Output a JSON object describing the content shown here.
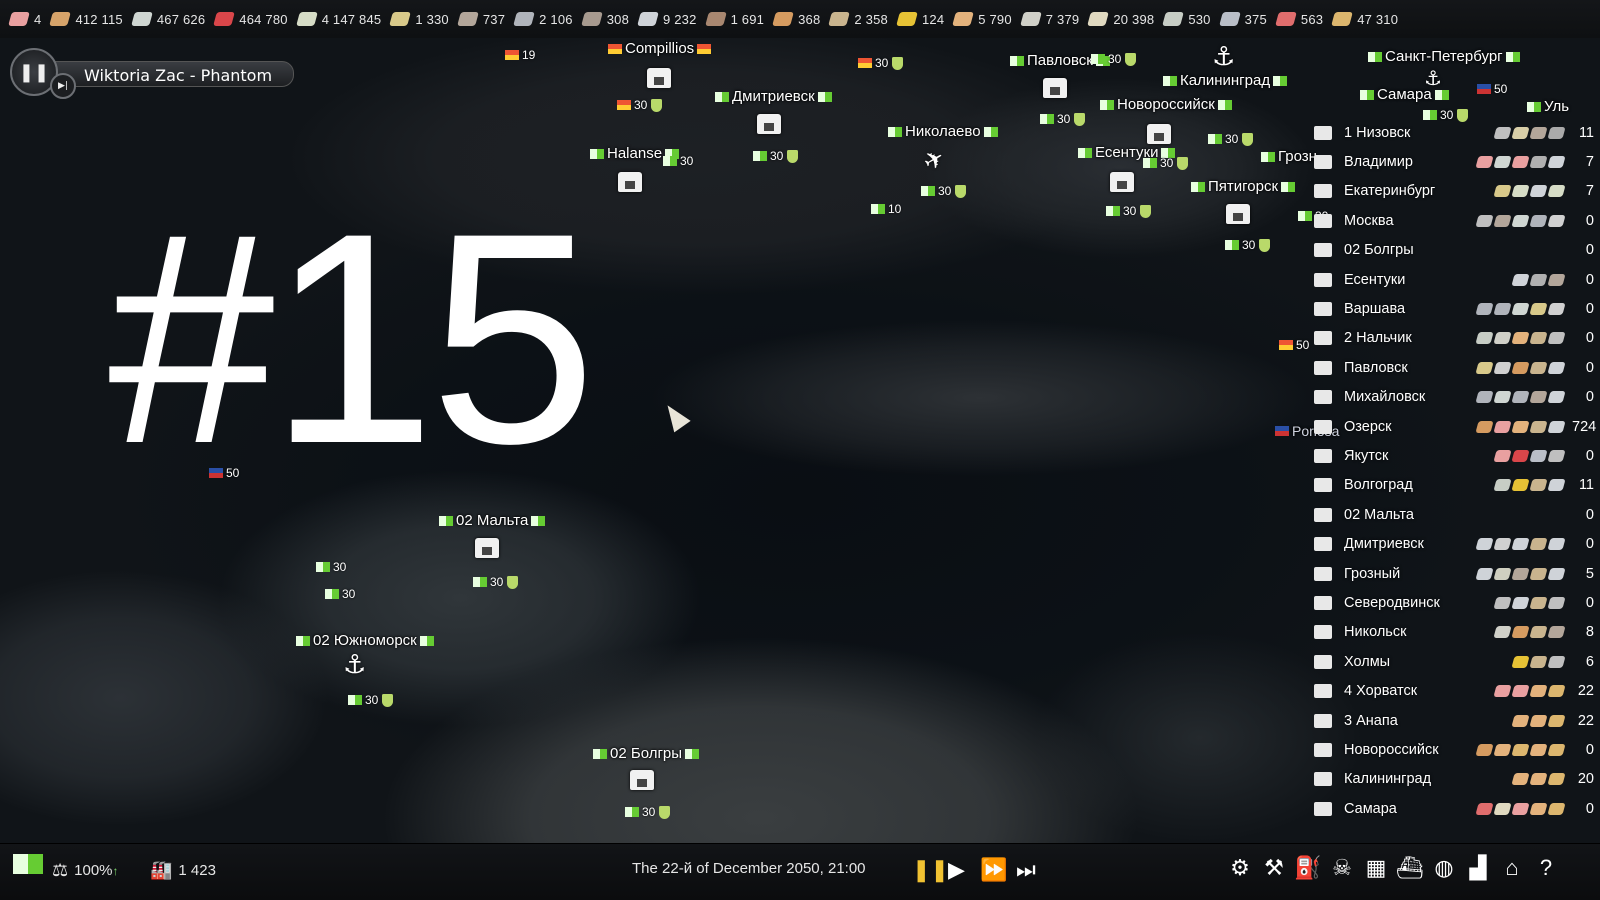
{
  "resources": [
    {
      "value": "4",
      "color": "#e9a0a0"
    },
    {
      "value": "412 115",
      "color": "#d6a36a"
    },
    {
      "value": "467 626",
      "color": "#cfd6d2"
    },
    {
      "value": "464 780",
      "color": "#d9464a"
    },
    {
      "value": "4 147 845",
      "color": "#d6dcc6"
    },
    {
      "value": "1 330",
      "color": "#d8c98a"
    },
    {
      "value": "737",
      "color": "#b3a69a"
    },
    {
      "value": "2 106",
      "color": "#b0b4bb"
    },
    {
      "value": "308",
      "color": "#a79a8f"
    },
    {
      "value": "9 232",
      "color": "#cfd3d8"
    },
    {
      "value": "1 691",
      "color": "#a88770"
    },
    {
      "value": "368",
      "color": "#d59b60"
    },
    {
      "value": "2 358",
      "color": "#c9b48e"
    },
    {
      "value": "124",
      "color": "#e6c235"
    },
    {
      "value": "5 790",
      "color": "#e3b27c"
    },
    {
      "value": "7 379",
      "color": "#d0d0c8"
    },
    {
      "value": "20 398",
      "color": "#e0d9c0"
    },
    {
      "value": "530",
      "color": "#c7cdc5"
    },
    {
      "value": "375",
      "color": "#b9bec7"
    },
    {
      "value": "563",
      "color": "#e06d6d"
    },
    {
      "value": "47 310",
      "color": "#dcb66e"
    }
  ],
  "player": {
    "track": "Wiktoria Zac - Phantom",
    "pause_icon": "pause-icon",
    "next_icon": "skip-next-icon"
  },
  "episode": "#15",
  "map": {
    "cities": [
      {
        "name": "Compillios",
        "flag": "red"
      },
      {
        "name": "Дмитриевск",
        "flag": "green"
      },
      {
        "name": "Halanse",
        "flag": "green"
      },
      {
        "name": "Николаево",
        "flag": "green"
      },
      {
        "name": "Павловск",
        "flag": "green"
      },
      {
        "name": "Калининград",
        "flag": "green"
      },
      {
        "name": "Новороссийск",
        "flag": "green"
      },
      {
        "name": "Есентуки",
        "flag": "green"
      },
      {
        "name": "Пятигорск",
        "flag": "green"
      },
      {
        "name": "Грозн",
        "flag": "green"
      },
      {
        "name": "Санкт-Петербург",
        "flag": "green"
      },
      {
        "name": "Самара",
        "flag": "green"
      },
      {
        "name": "Уль",
        "flag": "green"
      },
      {
        "name": "02 Мальта",
        "flag": "green"
      },
      {
        "name": "02 Южноморск",
        "flag": "green"
      },
      {
        "name": "02 Болгры",
        "flag": "green"
      },
      {
        "name": "Poriosa",
        "flag": "blue"
      }
    ],
    "garrisons": [
      "19",
      "30",
      "30",
      "30",
      "30",
      "30",
      "10",
      "30",
      "30",
      "30",
      "30",
      "30",
      "30",
      "30",
      "50",
      "50",
      "50",
      "30",
      "30",
      "30",
      "30",
      "30",
      "30"
    ]
  },
  "city_list": [
    {
      "name": "1 Низовск",
      "count": "11",
      "goods": [
        "#bfbfbf",
        "#d9cfa8",
        "#b3a69a",
        "#aaaaaa"
      ]
    },
    {
      "name": "Владимир",
      "count": "7",
      "goods": [
        "#e9a0a0",
        "#cfd6d2",
        "#e9a0a0",
        "#b0b0b0",
        "#cfd3d8"
      ]
    },
    {
      "name": "Екатеринбург",
      "count": "7",
      "goods": [
        "#d8c98a",
        "#d6dcc6",
        "#cfd3d8",
        "#d6dcc6"
      ]
    },
    {
      "name": "Москва",
      "count": "0",
      "goods": [
        "#bfbfbf",
        "#b3a69a",
        "#cfd6d2",
        "#b0b4bb",
        "#d0d0d0"
      ]
    },
    {
      "name": "02 Болгры",
      "count": "0",
      "goods": []
    },
    {
      "name": "Есентуки",
      "count": "0",
      "goods": [
        "#cfd3d8",
        "#b0b0b0",
        "#b3a69a"
      ]
    },
    {
      "name": "Варшава",
      "count": "0",
      "goods": [
        "#b0b4bb",
        "#b0b4bb",
        "#cfd6d2",
        "#d8c98a",
        "#d0d0d0"
      ]
    },
    {
      "name": "2 Нальчик",
      "count": "0",
      "goods": [
        "#c7cdc5",
        "#d0d0c8",
        "#e3b27c",
        "#c9b48e",
        "#bfbfbf"
      ]
    },
    {
      "name": "Павловск",
      "count": "0",
      "goods": [
        "#d8c98a",
        "#d0d0d0",
        "#d59b60",
        "#c9b48e",
        "#cfd3d8"
      ]
    },
    {
      "name": "Михайловск",
      "count": "0",
      "goods": [
        "#b0b4bb",
        "#cfd6d2",
        "#b0b4bb",
        "#b3a69a",
        "#cfd3d8"
      ]
    },
    {
      "name": "Озерск",
      "count": "724",
      "goods": [
        "#d59b60",
        "#e9a0a0",
        "#e3b27c",
        "#c9b48e",
        "#cfd3d8"
      ]
    },
    {
      "name": "Якутск",
      "count": "0",
      "goods": [
        "#e9a0a0",
        "#d9464a",
        "#b9bec7",
        "#bfbfbf"
      ]
    },
    {
      "name": "Волгоград",
      "count": "11",
      "goods": [
        "#c7cdc5",
        "#e6c235",
        "#c9b48e",
        "#cfd3d8"
      ]
    },
    {
      "name": "02 Мальта",
      "count": "0",
      "goods": []
    },
    {
      "name": "Дмитриевск",
      "count": "0",
      "goods": [
        "#cfd3d8",
        "#d0d0d0",
        "#cfd3d8",
        "#c9b48e",
        "#cfd3d8"
      ]
    },
    {
      "name": "Грозный",
      "count": "5",
      "goods": [
        "#cfd3d8",
        "#cfcfc0",
        "#b3a69a",
        "#c9b48e",
        "#cfd3d8"
      ]
    },
    {
      "name": "Северодвинск",
      "count": "0",
      "goods": [
        "#bfbfbf",
        "#cfd3d8",
        "#c9b48e",
        "#bfbfbf"
      ]
    },
    {
      "name": "Никольск",
      "count": "8",
      "goods": [
        "#d0d0c8",
        "#d59b60",
        "#c9b48e",
        "#b3a69a"
      ]
    },
    {
      "name": "Холмы",
      "count": "6",
      "goods": [
        "#e6c235",
        "#c9b48e",
        "#bfbfbf"
      ]
    },
    {
      "name": "4 Хорватск",
      "count": "22",
      "goods": [
        "#e9a0a0",
        "#e9a0a0",
        "#e3b27c",
        "#dcb66e"
      ]
    },
    {
      "name": "3 Анапа",
      "count": "22",
      "goods": [
        "#e3b27c",
        "#e3b27c",
        "#dcb66e"
      ]
    },
    {
      "name": "Новороссийск",
      "count": "0",
      "goods": [
        "#d59b60",
        "#e3b27c",
        "#dcb66e",
        "#e3b27c",
        "#dcb66e"
      ]
    },
    {
      "name": "Калининград",
      "count": "20",
      "goods": [
        "#e3b27c",
        "#e3b27c",
        "#dcb66e"
      ]
    },
    {
      "name": "Самара",
      "count": "0",
      "goods": [
        "#e06d6d",
        "#e0d9c0",
        "#e9a0a0",
        "#e3b27c",
        "#dcb66e"
      ]
    }
  ],
  "bottom": {
    "stability": "100%",
    "population": "1 423",
    "date": "The 22-й of December 2050, 21:00",
    "speed_icons": [
      "pause-icon",
      "play-icon",
      "fast-forward-icon",
      "fastest-icon"
    ],
    "tools": [
      "settings-icon",
      "build-icon",
      "industry-icon",
      "military-icon",
      "city-icon",
      "factory-icon",
      "globe-icon",
      "stats-icon",
      "government-icon",
      "help-icon"
    ]
  }
}
